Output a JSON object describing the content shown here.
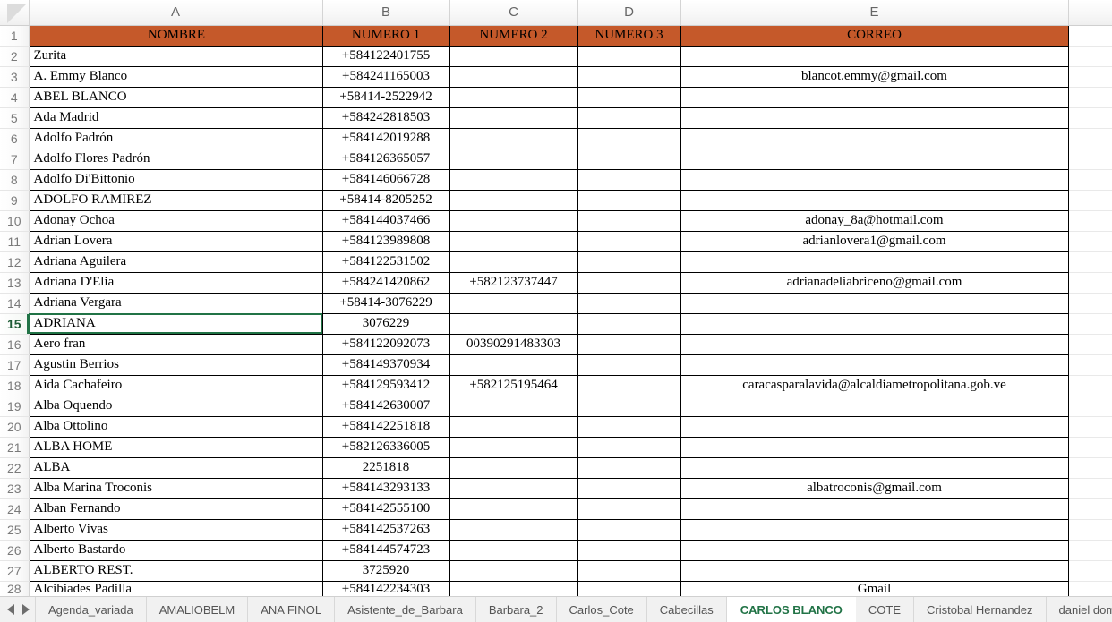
{
  "colors": {
    "header_banner": "#C5592A",
    "active_tab_text": "#217346",
    "selection": "#217346"
  },
  "grid": {
    "column_letters": [
      "A",
      "B",
      "C",
      "D",
      "E"
    ],
    "headers": {
      "a": "NOMBRE",
      "b": "NUMERO  1",
      "c": "NUMERO  2",
      "d": "NUMERO  3",
      "e": "CORREO"
    },
    "selected_cell": "A15",
    "rows": [
      {
        "n": "1",
        "a": "NOMBRE",
        "b": "NUMERO  1",
        "c": "NUMERO  2",
        "d": "NUMERO  3",
        "e": "CORREO",
        "banner": true
      },
      {
        "n": "2",
        "a": " Zurita",
        "b": "+584122401755",
        "c": "",
        "d": "",
        "e": ""
      },
      {
        "n": "3",
        "a": "A.  Emmy Blanco",
        "b": "+584241165003",
        "c": "",
        "d": "",
        "e": "blancot.emmy@gmail.com"
      },
      {
        "n": "4",
        "a": "ABEL  BLANCO",
        "b": "+58414-2522942",
        "c": "",
        "d": "",
        "e": ""
      },
      {
        "n": "5",
        "a": "Ada  Madrid",
        "b": "+584242818503",
        "c": "",
        "d": "",
        "e": ""
      },
      {
        "n": "6",
        "a": "Adolfo  Padrón",
        "b": "+584142019288",
        "c": "",
        "d": "",
        "e": ""
      },
      {
        "n": "7",
        "a": "Adolfo  Flores Padrón",
        "b": "+584126365057",
        "c": "",
        "d": "",
        "e": ""
      },
      {
        "n": "8",
        "a": "Adolfo  Di'Bittonio",
        "b": "+584146066728",
        "c": "",
        "d": "",
        "e": ""
      },
      {
        "n": "9",
        "a": "ADOLFO  RAMIREZ",
        "b": "+58414-8205252",
        "c": "",
        "d": "",
        "e": ""
      },
      {
        "n": "10",
        "a": "Adonay  Ochoa",
        "b": "+584144037466",
        "c": "",
        "d": "",
        "e": "adonay_8a@hotmail.com"
      },
      {
        "n": "11",
        "a": "Adrian  Lovera",
        "b": "+584123989808",
        "c": "",
        "d": "",
        "e": "adrianlovera1@gmail.com"
      },
      {
        "n": "12",
        "a": "Adriana  Aguilera",
        "b": "+584122531502",
        "c": "",
        "d": "",
        "e": ""
      },
      {
        "n": "13",
        "a": "Adriana  D'Elia",
        "b": "+584241420862",
        "c": "+582123737447",
        "d": "",
        "e": "adrianadeliabriceno@gmail.com"
      },
      {
        "n": "14",
        "a": "Adriana  Vergara",
        "b": "+58414-3076229",
        "c": "",
        "d": "",
        "e": ""
      },
      {
        "n": "15",
        "a": "ADRIANA",
        "b": "3076229",
        "c": "",
        "d": "",
        "e": "",
        "selected": true
      },
      {
        "n": "16",
        "a": "Aero fran",
        "b": "+584122092073",
        "c": "00390291483303",
        "d": "",
        "e": ""
      },
      {
        "n": "17",
        "a": "Agustin  Berrios",
        "b": "+584149370934",
        "c": "",
        "d": "",
        "e": ""
      },
      {
        "n": "18",
        "a": "Aida  Cachafeiro",
        "b": "+584129593412",
        "c": "+582125195464",
        "d": "",
        "e": "caracasparalavida@alcaldiametropolitana.gob.ve"
      },
      {
        "n": "19",
        "a": "Alba  Oquendo",
        "b": "+584142630007",
        "c": "",
        "d": "",
        "e": ""
      },
      {
        "n": "20",
        "a": "Alba  Ottolino",
        "b": "+584142251818",
        "c": "",
        "d": "",
        "e": ""
      },
      {
        "n": "21",
        "a": "ALBA  HOME",
        "b": "+582126336005",
        "c": "",
        "d": "",
        "e": ""
      },
      {
        "n": "22",
        "a": "ALBA",
        "b": "2251818",
        "c": "",
        "d": "",
        "e": ""
      },
      {
        "n": "23",
        "a": "Alba Marina  Troconis",
        "b": "+584143293133",
        "c": "",
        "d": "",
        "e": "albatroconis@gmail.com"
      },
      {
        "n": "24",
        "a": "Alban  Fernando",
        "b": "+584142555100",
        "c": "",
        "d": "",
        "e": ""
      },
      {
        "n": "25",
        "a": "Alberto  Vivas",
        "b": "+584142537263",
        "c": "",
        "d": "",
        "e": ""
      },
      {
        "n": "26",
        "a": "Alberto  Bastardo",
        "b": "+584144574723",
        "c": "",
        "d": "",
        "e": ""
      },
      {
        "n": "27",
        "a": "ALBERTO  REST.",
        "b": "3725920",
        "c": "",
        "d": "",
        "e": ""
      },
      {
        "n": "28",
        "a": "Alcibiades  Padilla",
        "b": "+584142234303",
        "c": "",
        "d": "",
        "e": "Gmail",
        "partial": true
      }
    ]
  },
  "tabbar": {
    "nav_prev_icon": "triangle-left-icon",
    "nav_next_icon": "triangle-right-icon",
    "active_tab": "CARLOS BLANCO",
    "tabs": [
      "Agenda_variada",
      "AMALIOBELM",
      "ANA FINOL",
      "Asistente_de_Barbara",
      "Barbara_2",
      "Carlos_Cote",
      "Cabecillas",
      "CARLOS BLANCO",
      "COTE",
      "Cristobal Hernandez",
      "daniel dominguez VP"
    ]
  }
}
